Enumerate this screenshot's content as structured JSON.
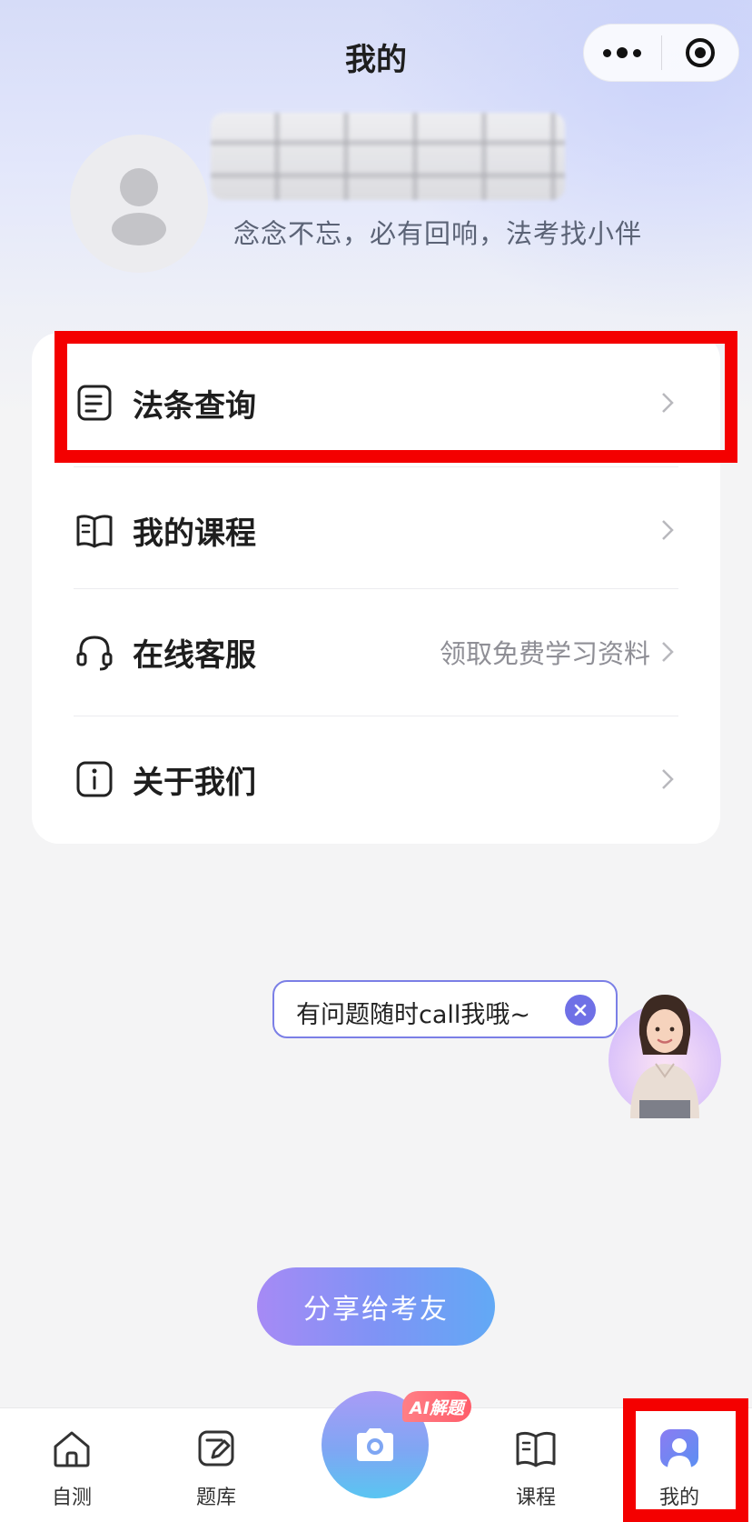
{
  "header": {
    "title": "我的"
  },
  "profile": {
    "motto": "念念不忘，必有回响，法考找小伴"
  },
  "menu": {
    "items": [
      {
        "label": "法条查询",
        "hint": "",
        "icon": "document-list-icon"
      },
      {
        "label": "我的课程",
        "hint": "",
        "icon": "open-book-icon"
      },
      {
        "label": "在线客服",
        "hint": "领取免费学习资料",
        "icon": "headset-icon"
      },
      {
        "label": "关于我们",
        "hint": "",
        "icon": "info-icon"
      }
    ]
  },
  "assistant": {
    "bubble_text": "有问题随时call我哦~"
  },
  "share": {
    "label": "分享给考友"
  },
  "tabbar": {
    "items": [
      {
        "label": "自测",
        "icon": "home-icon"
      },
      {
        "label": "题库",
        "icon": "edit-note-icon"
      },
      {
        "label": "",
        "icon": "camera-icon"
      },
      {
        "label": "课程",
        "icon": "book-icon"
      },
      {
        "label": "我的",
        "icon": "user-icon"
      }
    ],
    "camera_badge": "AI解题",
    "active_index": 4
  },
  "colors": {
    "accent": "#6f70e6",
    "active_tab": "#6c7df0",
    "highlight": "#f40000"
  }
}
